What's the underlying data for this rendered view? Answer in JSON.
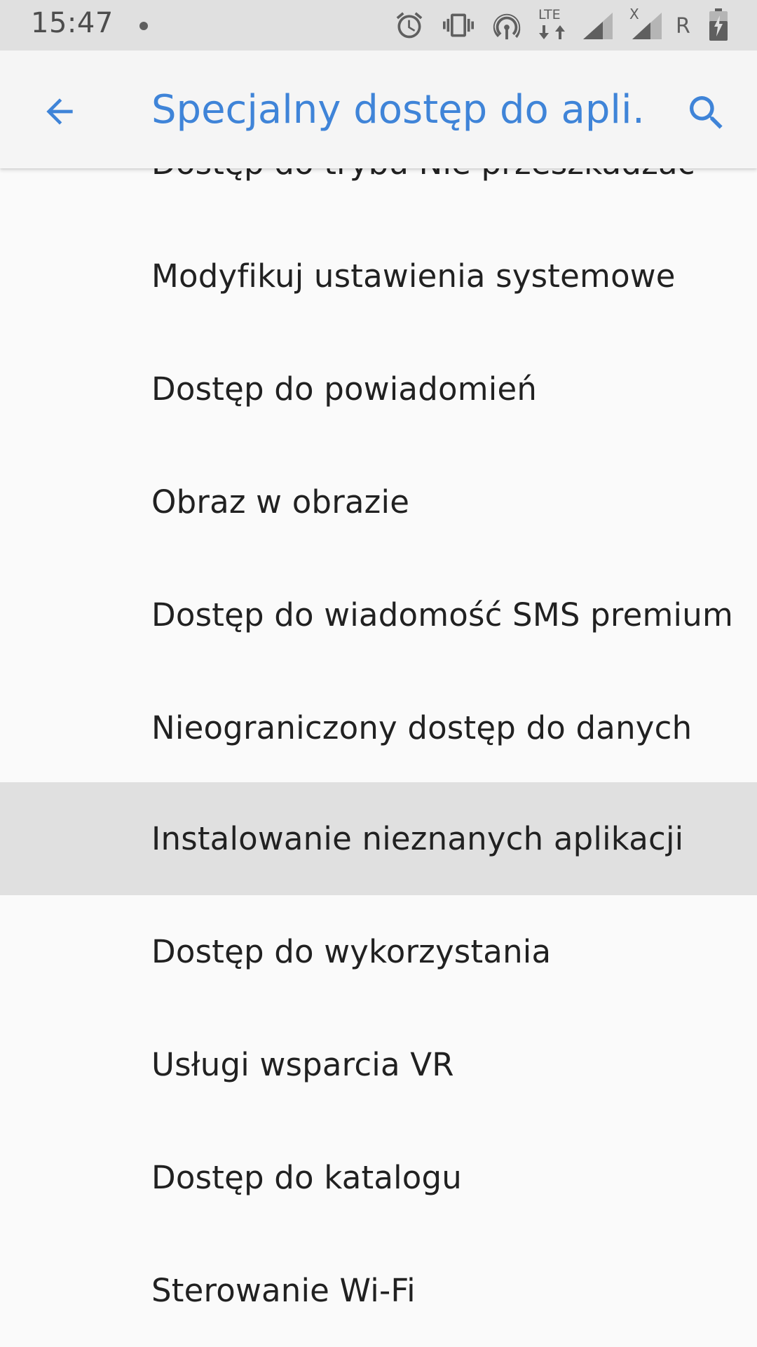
{
  "status_bar": {
    "time": "15:47",
    "network_label": "LTE",
    "roaming_label": "R",
    "no_signal_mark": "X",
    "icons": [
      "alarm-icon",
      "vibrate-icon",
      "hotspot-icon",
      "lte-data-icon",
      "signal-icon",
      "signal-no-data-icon",
      "roaming-icon",
      "battery-icon"
    ]
  },
  "app_bar": {
    "title": "Specjalny dostęp do apli…",
    "back_icon": "arrow-back-icon",
    "search_icon": "search-icon"
  },
  "list": {
    "items": [
      {
        "label": "Dostęp do trybu Nie przeszkadzać"
      },
      {
        "label": "Modyfikuj ustawienia systemowe"
      },
      {
        "label": "Dostęp do powiadomień"
      },
      {
        "label": "Obraz w obrazie"
      },
      {
        "label": "Dostęp do wiadomość SMS premium"
      },
      {
        "label": "Nieograniczony dostęp do danych"
      },
      {
        "label": "Instalowanie nieznanych aplikacji"
      },
      {
        "label": "Dostęp do wykorzystania"
      },
      {
        "label": "Usługi wsparcia VR"
      },
      {
        "label": "Dostęp do katalogu"
      },
      {
        "label": "Sterowanie Wi-Fi"
      }
    ]
  },
  "colors": {
    "accent": "#3f84d8",
    "status_bar_bg": "#e0e0e0",
    "app_bar_bg": "#f5f5f5",
    "list_bg": "#fafafa",
    "selected_bg": "#e0e0e0",
    "text_primary": "#212121"
  }
}
